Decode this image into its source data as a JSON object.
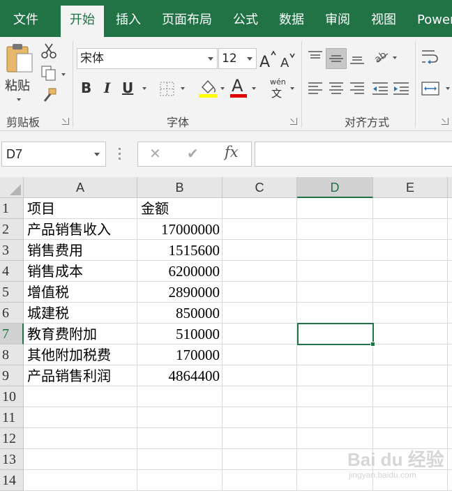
{
  "ribbon_tabs": [
    "文件",
    "开始",
    "插入",
    "页面布局",
    "公式",
    "数据",
    "审阅",
    "视图",
    "Power"
  ],
  "active_tab": "开始",
  "clipboard": {
    "paste_label": "粘贴",
    "group_label": "剪贴板"
  },
  "font": {
    "name": "宋体",
    "size": "12",
    "group_label": "字体",
    "bold": "B",
    "italic": "I",
    "underline": "U",
    "font_color_glyph": "A",
    "phonetic_top": "wén",
    "phonetic_bottom": "文"
  },
  "alignment": {
    "group_label": "对齐方式"
  },
  "formula_bar": {
    "name_box": "D7",
    "cancel_glyph": "✕",
    "enter_glyph": "✔",
    "fx_glyph": "fx",
    "value": ""
  },
  "columns": [
    "A",
    "B",
    "C",
    "D",
    "E"
  ],
  "selected_column": "D",
  "selected_row": "7",
  "rows": [
    {
      "num": "1",
      "a": "项目",
      "b": "金额",
      "b_is_text": true
    },
    {
      "num": "2",
      "a": "产品销售收入",
      "b": "17000000"
    },
    {
      "num": "3",
      "a": "销售费用",
      "b": "1515600"
    },
    {
      "num": "4",
      "a": "销售成本",
      "b": "6200000"
    },
    {
      "num": "5",
      "a": "增值税",
      "b": "2890000"
    },
    {
      "num": "6",
      "a": "城建税",
      "b": "850000"
    },
    {
      "num": "7",
      "a": "教育费附加",
      "b": "510000"
    },
    {
      "num": "8",
      "a": "其他附加税费",
      "b": "170000"
    },
    {
      "num": "9",
      "a": "产品销售利润",
      "b": "4864400"
    },
    {
      "num": "10",
      "a": "",
      "b": ""
    },
    {
      "num": "11",
      "a": "",
      "b": ""
    },
    {
      "num": "12",
      "a": "",
      "b": ""
    },
    {
      "num": "13",
      "a": "",
      "b": ""
    },
    {
      "num": "14",
      "a": "",
      "b": ""
    }
  ],
  "watermark": {
    "main": "Bai du 经验",
    "sub": "jingyan.baidu.com"
  },
  "colors": {
    "excel_green": "#217346",
    "ribbon_bg": "#f3f3f3",
    "highlight_yellow": "#ffff00",
    "font_red": "#e00000"
  }
}
